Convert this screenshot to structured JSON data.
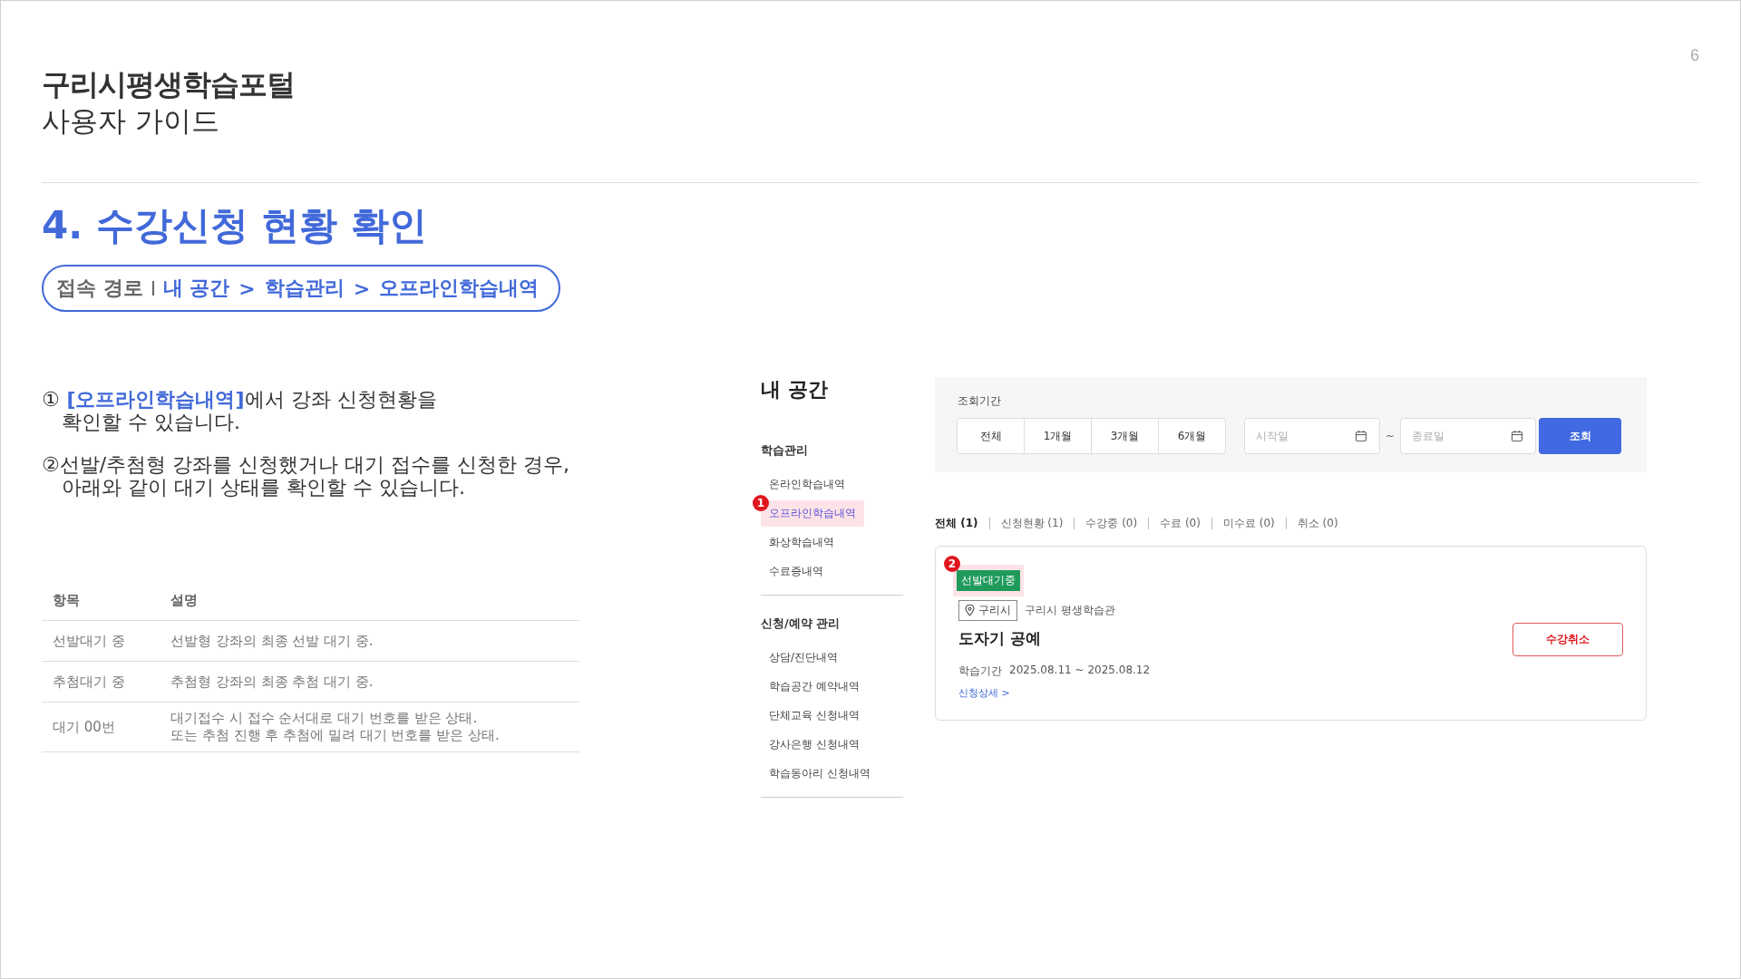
{
  "header": {
    "title": "구리시평생학습포털",
    "subtitle": "사용자 가이드",
    "page_number": "6"
  },
  "section": {
    "heading": "4. 수강신청 현황 확인",
    "path_label": "접속 경로",
    "path": [
      "내 공간",
      "학습관리",
      "오프라인학습내역"
    ],
    "path_separator": ">"
  },
  "instructions": [
    {
      "marker": "①",
      "highlight": "[오프라인학습내역]",
      "lines": [
        "에서 강좌 신청현황을",
        "확인할 수 있습니다."
      ]
    },
    {
      "marker": "②",
      "lines": [
        "선발/추첨형 강좌를 신청했거나 대기 접수를 신청한 경우,",
        "아래와 같이 대기 상태를 확인할 수 있습니다."
      ]
    }
  ],
  "status_table": {
    "columns": [
      "항목",
      "설명"
    ],
    "rows": [
      {
        "item": "선발대기 중",
        "description": [
          "선발형 강좌의 최종 선발 대기 중."
        ]
      },
      {
        "item": "추첨대기 중",
        "description": [
          "추첨형 강좌의 최종 추첨 대기 중."
        ]
      },
      {
        "item": "대기 00번",
        "description": [
          "대기접수 시 접수 순서대로 대기 번호를 받은 상태.",
          "또는 추첨 진행 후 추첨에 밀려 대기 번호를 받은 상태."
        ]
      }
    ]
  },
  "screenshot": {
    "sidebar": {
      "title": "내 공간",
      "groups": [
        {
          "title": "학습관리",
          "items": [
            {
              "label": "온라인학습내역",
              "selected": false
            },
            {
              "label": "오프라인학습내역",
              "selected": true,
              "callout": "1"
            },
            {
              "label": "화상학습내역",
              "selected": false
            },
            {
              "label": "수료증내역",
              "selected": false
            }
          ]
        },
        {
          "title": "신청/예약 관리",
          "items": [
            {
              "label": "상담/진단내역",
              "selected": false
            },
            {
              "label": "학습공간 예약내역",
              "selected": false
            },
            {
              "label": "단체교육 신청내역",
              "selected": false
            },
            {
              "label": "강사은행 신청내역",
              "selected": false
            },
            {
              "label": "학습동아리 신청내역",
              "selected": false
            }
          ]
        }
      ]
    },
    "filter": {
      "label": "조회기간",
      "periods": [
        {
          "label": "전체",
          "selected": false
        },
        {
          "label": "1개월",
          "selected": false
        },
        {
          "label": "3개월",
          "selected": false
        },
        {
          "label": "6개월",
          "selected": false
        }
      ],
      "start": {
        "placeholder": "시작일"
      },
      "separator": "~",
      "end": {
        "placeholder": "종료일"
      },
      "search_button": "조회"
    },
    "status_tabs": [
      {
        "label": "전체 (1)",
        "selected": true
      },
      {
        "label": "신청현황 (1)",
        "selected": false
      },
      {
        "label": "수강중 (0)",
        "selected": false
      },
      {
        "label": "수료 (0)",
        "selected": false
      },
      {
        "label": "미수료 (0)",
        "selected": false
      },
      {
        "label": "취소 (0)",
        "selected": false
      }
    ],
    "course_card": {
      "callout": "2",
      "status": "선발대기중",
      "color": "#1f9a5a",
      "region": "구리시",
      "venue": "구리시 평생학습관",
      "title": "도자기 공예",
      "period_label": "학습기간",
      "period": "2025.08.11 ~ 2025.08.12",
      "detail_link": "신청상세 >",
      "cancel_button": "수강취소"
    }
  }
}
